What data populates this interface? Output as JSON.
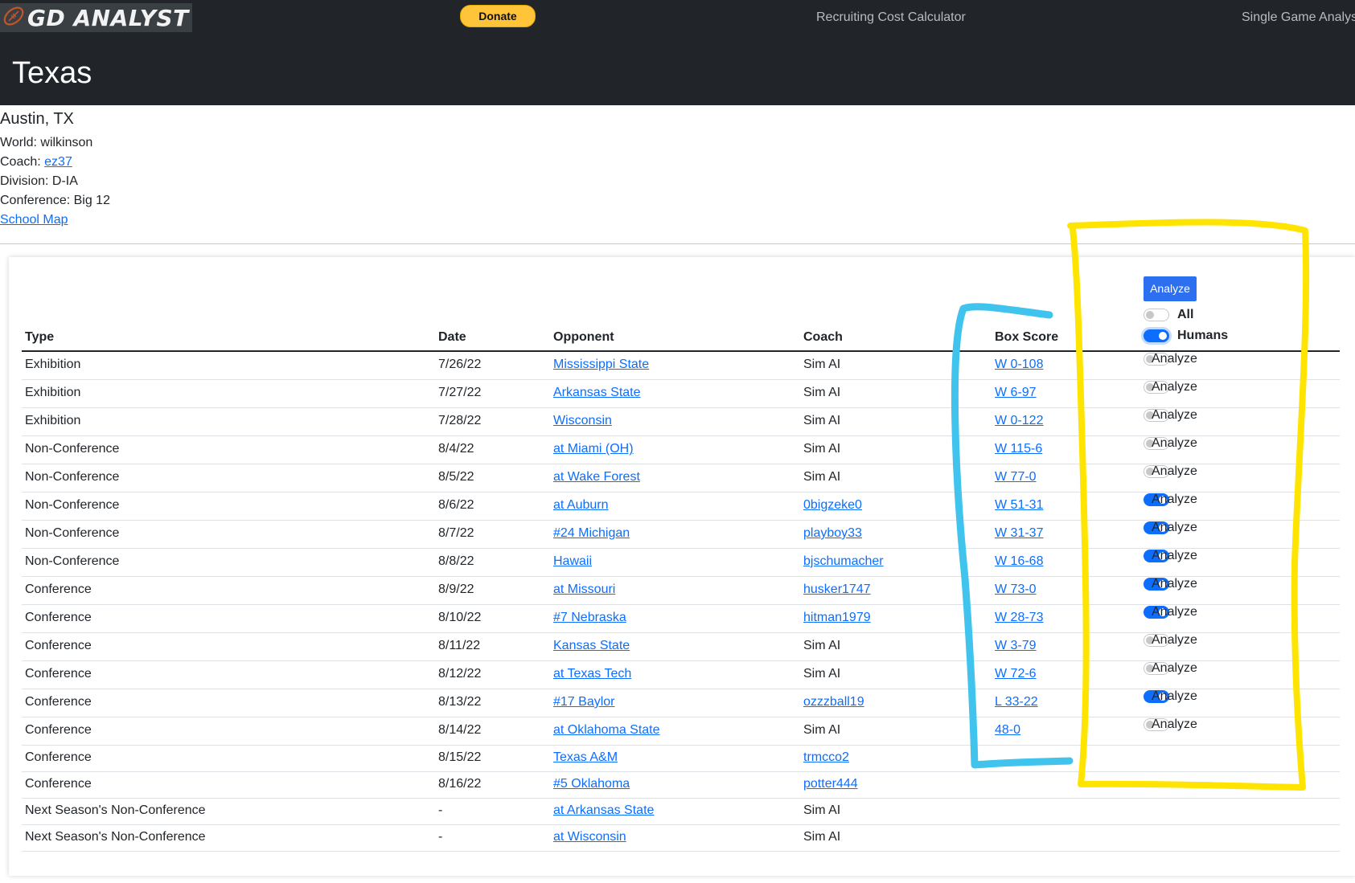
{
  "brand": {
    "name": "GD ANALYST",
    "icon": "football-icon"
  },
  "nav": {
    "donate_label": "Donate",
    "recruiting": "Recruiting Cost Calculator",
    "single_game": "Single Game Analysis"
  },
  "team": {
    "name": "Texas",
    "city": "Austin, TX",
    "world": "World: wilkinson",
    "coach_label": "Coach: ",
    "coach": "ez37",
    "division": "Division: D-IA",
    "conference": "Conference: Big 12",
    "school_map": "School Map"
  },
  "controls": {
    "analyze_button": "Analyze",
    "all_label": "All",
    "all_on": false,
    "humans_label": "Humans",
    "humans_on": true
  },
  "table": {
    "headers": {
      "type": "Type",
      "date": "Date",
      "opponent": "Opponent",
      "coach": "Coach",
      "box": "Box Score"
    },
    "row_toggle_label": "Analyze",
    "rows": [
      {
        "type": "Exhibition",
        "date": "7/26/22",
        "opponent": "Mississippi State",
        "coach": "Sim AI",
        "coach_link": false,
        "box": "W 0-108",
        "analyze": false
      },
      {
        "type": "Exhibition",
        "date": "7/27/22",
        "opponent": "Arkansas State",
        "coach": "Sim AI",
        "coach_link": false,
        "box": "W 6-97",
        "analyze": false
      },
      {
        "type": "Exhibition",
        "date": "7/28/22",
        "opponent": "Wisconsin",
        "coach": "Sim AI",
        "coach_link": false,
        "box": "W 0-122",
        "analyze": false
      },
      {
        "type": "Non-Conference",
        "date": "8/4/22",
        "opponent": "at Miami (OH)",
        "coach": "Sim AI",
        "coach_link": false,
        "box": "W 115-6",
        "analyze": false
      },
      {
        "type": "Non-Conference",
        "date": "8/5/22",
        "opponent": "at Wake Forest",
        "coach": "Sim AI",
        "coach_link": false,
        "box": "W 77-0",
        "analyze": false
      },
      {
        "type": "Non-Conference",
        "date": "8/6/22",
        "opponent": "at Auburn",
        "coach": "0bigzeke0",
        "coach_link": true,
        "box": "W 51-31",
        "analyze": true
      },
      {
        "type": "Non-Conference",
        "date": "8/7/22",
        "opponent": "#24 Michigan",
        "coach": "playboy33",
        "coach_link": true,
        "box": "W 31-37",
        "analyze": true
      },
      {
        "type": "Non-Conference",
        "date": "8/8/22",
        "opponent": "Hawaii",
        "coach": "bjschumacher",
        "coach_link": true,
        "box": "W 16-68",
        "analyze": true
      },
      {
        "type": "Conference",
        "date": "8/9/22",
        "opponent": "at Missouri",
        "coach": "husker1747",
        "coach_link": true,
        "box": "W 73-0",
        "analyze": true
      },
      {
        "type": "Conference",
        "date": "8/10/22",
        "opponent": "#7 Nebraska",
        "coach": "hitman1979",
        "coach_link": true,
        "box": "W 28-73",
        "analyze": true
      },
      {
        "type": "Conference",
        "date": "8/11/22",
        "opponent": "Kansas State",
        "coach": "Sim AI",
        "coach_link": false,
        "box": "W 3-79",
        "analyze": false
      },
      {
        "type": "Conference",
        "date": "8/12/22",
        "opponent": "at Texas Tech",
        "coach": "Sim AI",
        "coach_link": false,
        "box": "W 72-6",
        "analyze": false
      },
      {
        "type": "Conference",
        "date": "8/13/22",
        "opponent": "#17 Baylor",
        "coach": "ozzzball19",
        "coach_link": true,
        "box": "L 33-22",
        "analyze": true
      },
      {
        "type": "Conference",
        "date": "8/14/22",
        "opponent": "at Oklahoma State",
        "coach": "Sim AI",
        "coach_link": false,
        "box": "48-0",
        "analyze": false
      },
      {
        "type": "Conference",
        "date": "8/15/22",
        "opponent": "Texas A&M",
        "coach": "trmcco2",
        "coach_link": true,
        "box": "",
        "analyze": null
      },
      {
        "type": "Conference",
        "date": "8/16/22",
        "opponent": "#5 Oklahoma",
        "coach": "potter444",
        "coach_link": true,
        "box": "",
        "analyze": null
      },
      {
        "type": "Next Season's Non-Conference",
        "date": "-",
        "opponent": "at Arkansas State",
        "coach": "Sim AI",
        "coach_link": false,
        "box": "",
        "analyze": null
      },
      {
        "type": "Next Season's Non-Conference",
        "date": "-",
        "opponent": "at Wisconsin",
        "coach": "Sim AI",
        "coach_link": false,
        "box": "",
        "analyze": null
      }
    ]
  },
  "annotations": {
    "blue_color": "#40c4ee",
    "yellow_color": "#ffe400"
  }
}
